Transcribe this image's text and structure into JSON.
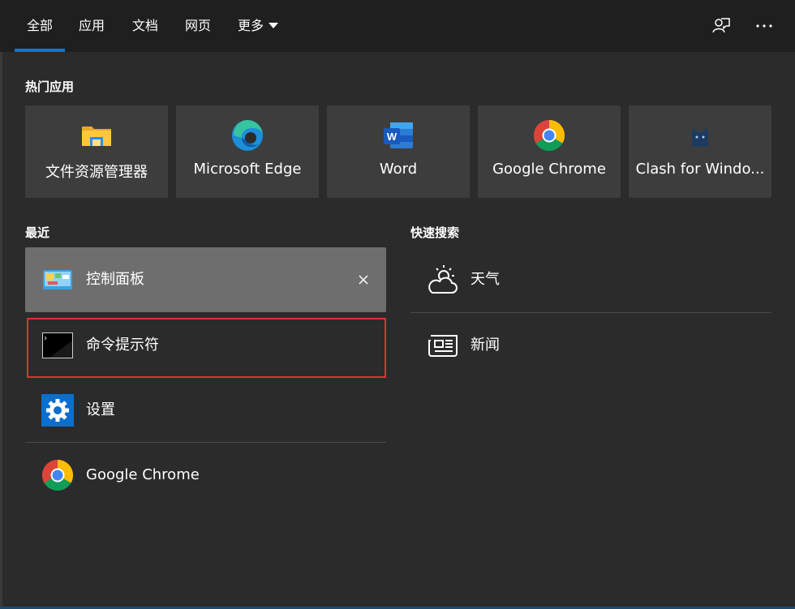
{
  "tabs": [
    {
      "label": "全部",
      "active": true
    },
    {
      "label": "应用"
    },
    {
      "label": "文档"
    },
    {
      "label": "网页"
    },
    {
      "label": "更多"
    }
  ],
  "header_icons": [
    "feedback-icon",
    "more-options-icon"
  ],
  "top_apps": {
    "title": "热门应用",
    "items": [
      {
        "label": "文件资源管理器",
        "icon": "file-explorer-icon"
      },
      {
        "label": "Microsoft Edge",
        "icon": "edge-icon"
      },
      {
        "label": "Word",
        "icon": "word-icon"
      },
      {
        "label": "Google Chrome",
        "icon": "chrome-icon"
      },
      {
        "label": "Clash for Windo...",
        "icon": "clash-icon"
      }
    ]
  },
  "recent": {
    "title": "最近",
    "items": [
      {
        "label": "控制面板",
        "icon": "control-panel-icon"
      },
      {
        "label": "命令提示符",
        "icon": "command-prompt-icon"
      },
      {
        "label": "设置",
        "icon": "settings-gear-icon"
      },
      {
        "label": "Google Chrome",
        "icon": "chrome-icon"
      }
    ]
  },
  "quick_search": {
    "title": "快速搜索",
    "items": [
      {
        "label": "天气",
        "icon": "weather-icon"
      },
      {
        "label": "新闻",
        "icon": "news-icon"
      }
    ]
  },
  "colors": {
    "accent": "#0a78d7",
    "highlight": "#e03131",
    "tile_bg": "#3d3d3d",
    "panel_bg": "#2b2b2b",
    "header_bg": "#1f1f1f"
  }
}
